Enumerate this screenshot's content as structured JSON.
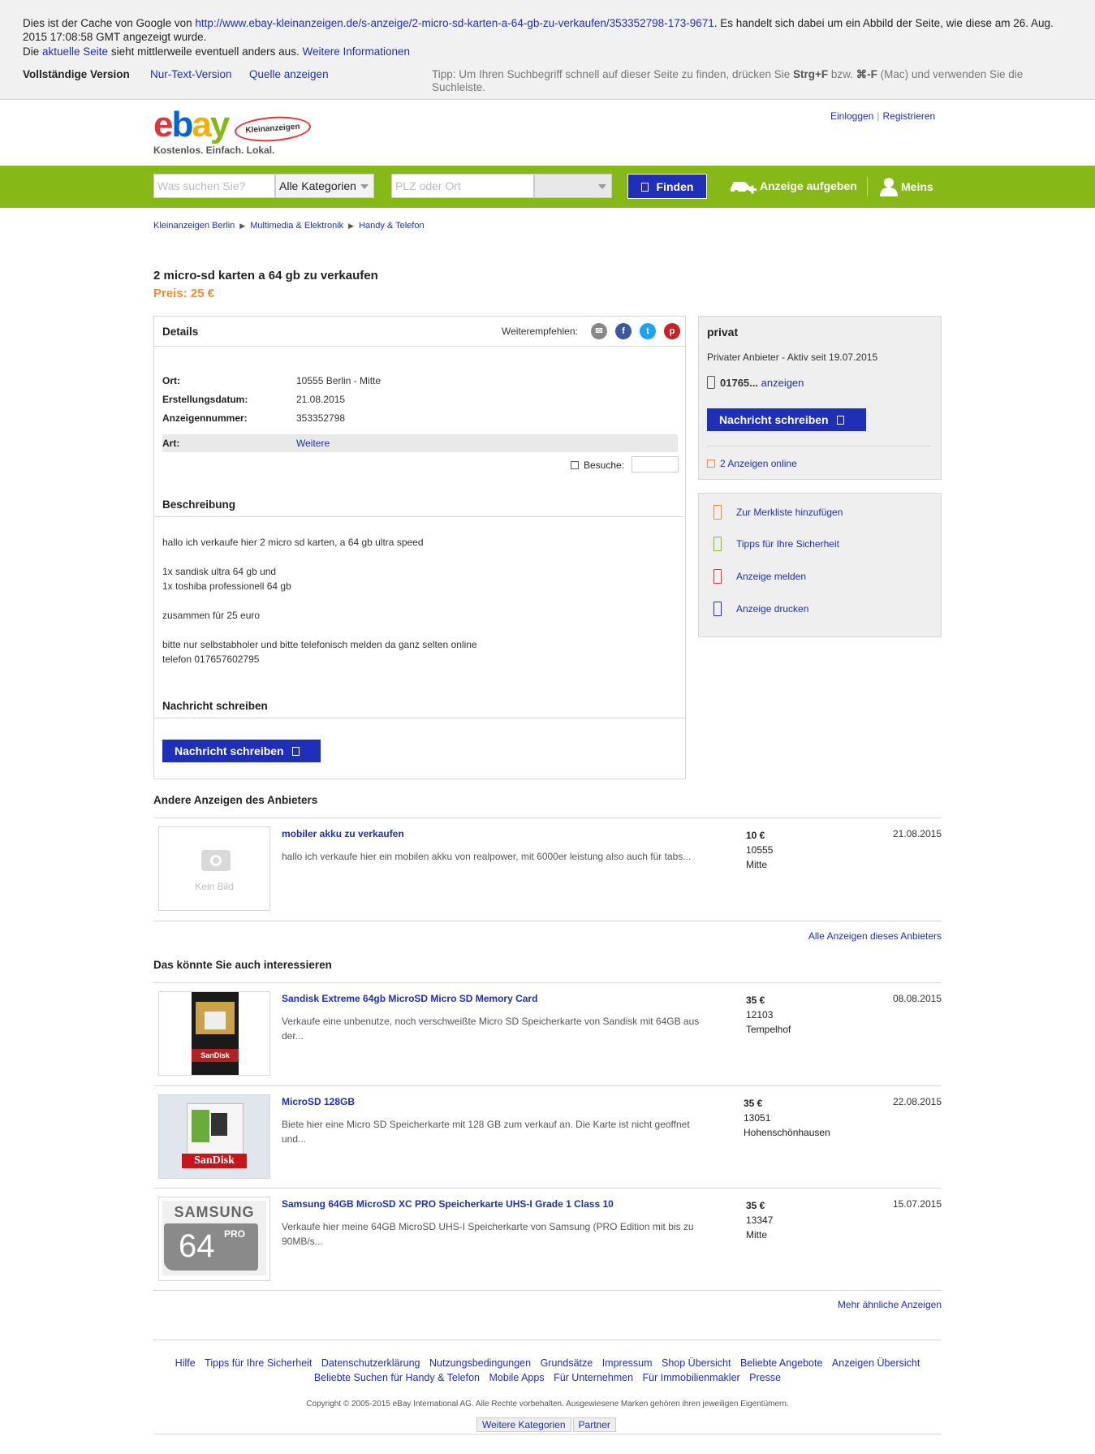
{
  "cache": {
    "line1_a": "Dies ist der Cache von Google von ",
    "line1_url": "http://www.ebay-kleinanzeigen.de/s-anzeige/2-micro-sd-karten-a-64-gb-zu-verkaufen/353352798-173-9671",
    "line1_b": ". Es handelt sich dabei um ein Abbild der Seite, wie diese am 26. Aug. 2015 17:08:58 GMT angezeigt wurde.",
    "line2_a": "Die ",
    "line2_link": "aktuelle Seite",
    "line2_b": " sieht mittlerweile eventuell anders aus. ",
    "line2_more": "Weitere Informationen",
    "full_version": "Vollständige Version",
    "text_version": "Nur-Text-Version",
    "source": "Quelle anzeigen",
    "tip_a": "Tipp: Um Ihren Suchbegriff schnell auf dieser Seite zu finden, drücken Sie ",
    "tip_key1": "Strg+F",
    "tip_b": " bzw. ",
    "tip_key2": "⌘-F",
    "tip_c": " (Mac) und verwenden Sie die Suchleiste."
  },
  "header": {
    "logo_e": "e",
    "logo_b": "b",
    "logo_a": "a",
    "logo_y": "y",
    "logo_badge": "Kleinanzeigen",
    "slogan": "Kostenlos. Einfach. Lokal.",
    "login": "Einloggen",
    "sep": "|",
    "register": "Registrieren"
  },
  "searchbar": {
    "query_placeholder": "Was suchen Sie?",
    "category": "Alle Kategorien",
    "location_placeholder": "PLZ oder Ort",
    "find": "Finden",
    "post_ad": "Anzeige aufgeben",
    "mine": "Meins"
  },
  "breadcrumb": [
    "Kleinanzeigen Berlin",
    "Multimedia & Elektronik",
    "Handy & Telefon"
  ],
  "ad": {
    "title": "2 micro-sd karten a 64 gb zu verkaufen",
    "price": "Preis: 25 €",
    "details_heading": "Details",
    "share_label": "Weiterempfehlen:",
    "rows": [
      {
        "k": "Ort:",
        "v": "10555 Berlin - Mitte"
      },
      {
        "k": "Erstellungsdatum:",
        "v": "21.08.2015"
      },
      {
        "k": "Anzeigennummer:",
        "v": "353352798"
      }
    ],
    "art_label": "Art:",
    "art_value": "Weitere",
    "visits_label": "Besuche:",
    "description_heading": "Beschreibung",
    "description": [
      "hallo ich verkaufe hier 2 micro sd karten, a 64 gb ultra speed",
      "",
      "1x sandisk ultra 64 gb und",
      "1x toshiba professionell 64 gb",
      "",
      "zusammen für 25 euro",
      "",
      "bitte nur selbstabholer und bitte telefonisch melden da ganz selten online",
      "telefon 017657602795"
    ],
    "message_heading": "Nachricht schreiben",
    "message_button": "Nachricht schreiben"
  },
  "seller": {
    "type": "privat",
    "since": "Privater Anbieter - Aktiv seit 19.07.2015",
    "phone": "01765...",
    "phone_show": "anzeigen",
    "message_button": "Nachricht schreiben",
    "online": "2 Anzeigen online"
  },
  "actions": [
    {
      "label": "Zur Merkliste hinzufügen",
      "color": "#f08c38"
    },
    {
      "label": "Tipps für Ihre Sicherheit",
      "color": "#86b817"
    },
    {
      "label": "Anzeige melden",
      "color": "#e53238"
    },
    {
      "label": "Anzeige drucken",
      "color": "#1f2fb8"
    }
  ],
  "other_ads": {
    "heading": "Andere Anzeigen des Anbieters",
    "items": [
      {
        "title": "mobiler akku zu verkaufen",
        "desc": "hallo ich verkaufe hier ein mobilen akku von realpower, mit 6000er leistung also auch für tabs...",
        "price": "10 €",
        "zip": "10555",
        "area": "Mitte",
        "date": "21.08.2015",
        "no_image": "Kein Bild"
      }
    ],
    "all_link": "Alle Anzeigen dieses Anbieters"
  },
  "similar": {
    "heading": "Das könnte Sie auch interessieren",
    "items": [
      {
        "title": "Sandisk Extreme 64gb MicroSD Micro SD Memory Card",
        "desc": "Verkaufe eine unbenutze, noch verschweißte Micro SD Speicherkarte von Sandisk mit 64GB aus der...",
        "price": "35 €",
        "zip": "12103",
        "area": "Tempelhof",
        "date": "08.08.2015",
        "img_text": "SanDisk"
      },
      {
        "title": "MicroSD 128GB",
        "desc": "Biete hier eine Micro SD Speicherkarte mit 128 GB zum verkauf an. Die Karte ist nicht geoffnet und...",
        "price": "35 €",
        "zip": "13051",
        "area": "Hohenschönhausen",
        "date": "22.08.2015",
        "img_text": "SanDisk"
      },
      {
        "title": "Samsung 64GB MicroSD XC PRO Speicherkarte UHS-I Grade 1 Class 10",
        "desc": "Verkaufe hier meine 64GB MicroSD UHS-I Speicherkarte von Samsung (PRO Edition mit bis zu 90MB/s...",
        "price": "35 €",
        "zip": "13347",
        "area": "Mitte",
        "date": "15.07.2015",
        "img_brand": "SAMSUNG",
        "img_num": "64",
        "img_pro": "PRO"
      }
    ],
    "more_link": "Mehr ähnliche Anzeigen"
  },
  "footer": {
    "links_row1": [
      "Hilfe",
      "Tipps für Ihre Sicherheit",
      "Datenschutzerklärung",
      "Nutzungsbedingungen",
      "Grundsätze",
      "Impressum",
      "Shop Übersicht",
      "Beliebte Angebote",
      "Anzeigen Übersicht"
    ],
    "links_row2": [
      "Beliebte Suchen für Handy & Telefon",
      "Mobile Apps",
      "Für Unternehmen",
      "Für Immobilienmakler",
      "Presse"
    ],
    "copyright": "Copyright © 2005-2015 eBay International AG. Alle Rechte vorbehalten. Ausgewiesene Marken gehören ihren jeweiligen Eigentümern.",
    "tab1": "Weitere Kategorien",
    "tab2": "Partner"
  }
}
